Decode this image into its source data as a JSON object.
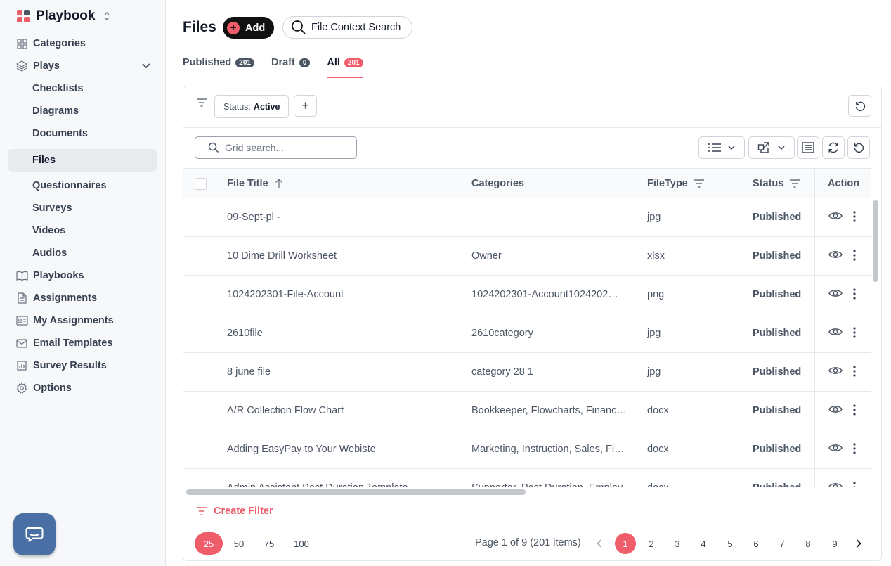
{
  "app": {
    "name": "Playbook",
    "logo_colors": [
      "#ef5d6a",
      "#4b5563",
      "#ef5d6a",
      "#ef5d6a"
    ]
  },
  "sidebar": {
    "items": [
      {
        "label": "Categories",
        "icon": "grid-icon"
      },
      {
        "label": "Plays",
        "icon": "layers-icon",
        "expanded": true
      },
      {
        "label": "Checklists",
        "sub": true
      },
      {
        "label": "Diagrams",
        "sub": true
      },
      {
        "label": "Documents",
        "sub": true
      },
      {
        "label": "Files",
        "sub": true,
        "active": true
      },
      {
        "label": "Questionnaires",
        "sub": true
      },
      {
        "label": "Surveys",
        "sub": true
      },
      {
        "label": "Videos",
        "sub": true
      },
      {
        "label": "Audios",
        "sub": true
      },
      {
        "label": "Playbooks",
        "icon": "book-icon"
      },
      {
        "label": "Assignments",
        "icon": "file-icon"
      },
      {
        "label": "My Assignments",
        "icon": "id-card-icon"
      },
      {
        "label": "Email Templates",
        "icon": "mail-icon"
      },
      {
        "label": "Survey Results",
        "icon": "bar-chart-icon"
      },
      {
        "label": "Options",
        "icon": "gear-icon"
      }
    ]
  },
  "header": {
    "title": "Files",
    "add_label": "Add",
    "context_search_label": "File Context Search"
  },
  "tabs": [
    {
      "label": "Published",
      "count": "201"
    },
    {
      "label": "Draft",
      "count": "0"
    },
    {
      "label": "All",
      "count": "201",
      "active": true
    }
  ],
  "filter": {
    "status_key": "Status:",
    "status_value": "Active"
  },
  "search": {
    "placeholder": "Grid search..."
  },
  "columns": {
    "title": "File Title",
    "categories": "Categories",
    "filetype": "FileType",
    "status": "Status",
    "action": "Action"
  },
  "rows": [
    {
      "title": "09-Sept-pl -",
      "categories": "",
      "filetype": "jpg",
      "status": "Published"
    },
    {
      "title": "10 Dime Drill Worksheet",
      "categories": "Owner",
      "filetype": "xlsx",
      "status": "Published"
    },
    {
      "title": "1024202301-File-Account",
      "categories": "1024202301-Account1024202…",
      "filetype": "png",
      "status": "Published"
    },
    {
      "title": "2610file",
      "categories": "2610category",
      "filetype": "jpg",
      "status": "Published"
    },
    {
      "title": "8 june file",
      "categories": "category 28 1",
      "filetype": "jpg",
      "status": "Published"
    },
    {
      "title": "A/R Collection Flow Chart",
      "categories": "Bookkeeper, Flowcharts, Financ…",
      "filetype": "docx",
      "status": "Published"
    },
    {
      "title": "Adding EasyPay to Your Webiste",
      "categories": "Marketing, Instruction, Sales, Fi…",
      "filetype": "docx",
      "status": "Published"
    },
    {
      "title": "Admin Assistant Post Duration Template",
      "categories": "Supporter, Post Duration, Employ…",
      "filetype": "docx",
      "status": "Published"
    }
  ],
  "footer": {
    "create_filter_label": "Create Filter",
    "page_sizes": [
      "25",
      "50",
      "75",
      "100"
    ],
    "active_page_size": "25",
    "page_info": "Page 1 of 9 (201 items)",
    "pages": [
      "1",
      "2",
      "3",
      "4",
      "5",
      "6",
      "7",
      "8",
      "9"
    ],
    "current_page": "1"
  },
  "colors": {
    "accent": "#ef5d6a",
    "dark_button": "#111111",
    "chat": "#4a6fa5"
  }
}
